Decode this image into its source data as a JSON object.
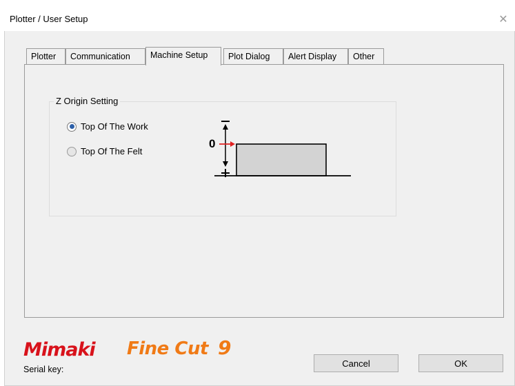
{
  "window": {
    "title": "Plotter / User Setup",
    "close_glyph": "✕"
  },
  "tabs": [
    {
      "label": "Plotter",
      "active": false
    },
    {
      "label": "Communication",
      "active": false
    },
    {
      "label": "Machine Setup",
      "active": true
    },
    {
      "label": "Plot Dialog",
      "active": false
    },
    {
      "label": "Alert Display",
      "active": false
    },
    {
      "label": "Other",
      "active": false
    }
  ],
  "z_origin": {
    "group_label": "Z Origin Setting",
    "options": [
      {
        "label": "Top Of The Work",
        "selected": true
      },
      {
        "label": "Top Of The Felt",
        "selected": false
      }
    ],
    "diagram": {
      "minus_label": "−",
      "zero_label": "0",
      "plus_label": "+",
      "arrow_color": "#e02020"
    }
  },
  "branding": {
    "maker": "Mimaki",
    "product_word": "Fine Cut",
    "product_number": "9",
    "maker_color": "#d8121b",
    "product_color": "#f07a16"
  },
  "footer": {
    "serial_label": "Serial key:",
    "cancel_label": "Cancel",
    "ok_label": "OK"
  }
}
